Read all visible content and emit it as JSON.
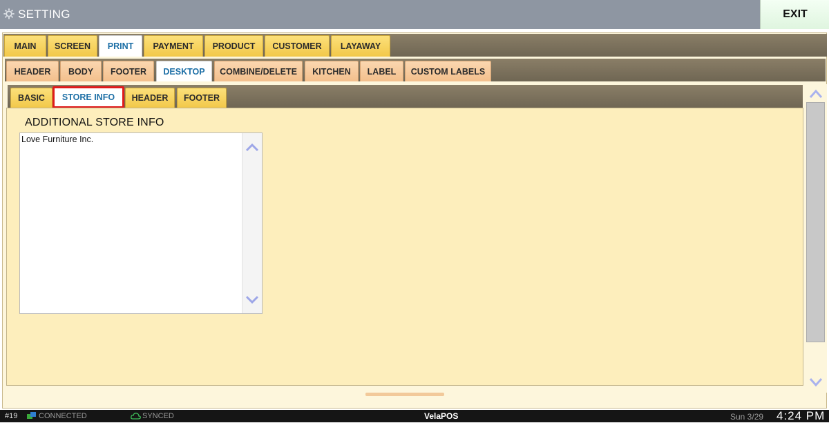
{
  "window": {
    "title": "SETTING",
    "exit_label": "EXIT"
  },
  "main_tabs": [
    {
      "label": "MAIN"
    },
    {
      "label": "SCREEN"
    },
    {
      "label": "PRINT",
      "active": true
    },
    {
      "label": "PAYMENT"
    },
    {
      "label": "PRODUCT"
    },
    {
      "label": "CUSTOMER"
    },
    {
      "label": "LAYAWAY"
    }
  ],
  "print_tabs": [
    {
      "label": "HEADER"
    },
    {
      "label": "BODY"
    },
    {
      "label": "FOOTER"
    },
    {
      "label": "DESKTOP",
      "active": true
    },
    {
      "label": "COMBINE/DELETE"
    },
    {
      "label": "KITCHEN"
    },
    {
      "label": "LABEL"
    },
    {
      "label": "CUSTOM LABELS"
    }
  ],
  "desktop_tabs": [
    {
      "label": "BASIC"
    },
    {
      "label": "STORE INFO",
      "active": true,
      "highlighted": true
    },
    {
      "label": "HEADER"
    },
    {
      "label": "FOOTER"
    }
  ],
  "store_info": {
    "section_label": "ADDITIONAL STORE INFO",
    "text_value": "Love Furniture Inc."
  },
  "status_bar": {
    "station": "#19",
    "connection": "CONNECTED",
    "sync": "SYNCED",
    "brand": "VelaPOS",
    "date": "Sun 3/29",
    "time": "4:24 PM"
  },
  "colors": {
    "title_bar": "#8e96a2",
    "tab_yellow": "#f2c84a",
    "tab_peach": "#f3bf8c",
    "panel_bg": "#fdeebc",
    "active_tab_text": "#1d6fa6",
    "highlight_border": "#e01b1b"
  },
  "icons": {
    "title": "gear-icon",
    "connection": "network-icon",
    "sync": "cloud-icon",
    "scroll_up": "chevron-up-icon",
    "scroll_down": "chevron-down-icon"
  }
}
